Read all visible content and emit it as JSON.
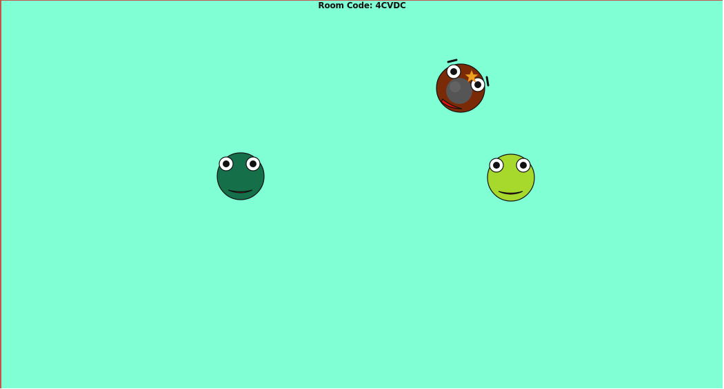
{
  "room": {
    "label": "Room Code: 4CVDC"
  },
  "colors": {
    "board_background": "#80ffd4",
    "board_border": "#c0564a",
    "player_dark_green": "#15704a",
    "player_lime": "#a6d92c",
    "player_brown": "#7a2a06",
    "bomb": "#555555",
    "mouth": "#e01010"
  },
  "players": [
    {
      "name": "player-dark-green",
      "body_icon": "frog-face-icon"
    },
    {
      "name": "player-lime-green",
      "body_icon": "frog-face-icon"
    },
    {
      "name": "player-brown-stunned",
      "body_icon": "bomb-icon",
      "effect_icon": "star-burst-icon"
    }
  ]
}
